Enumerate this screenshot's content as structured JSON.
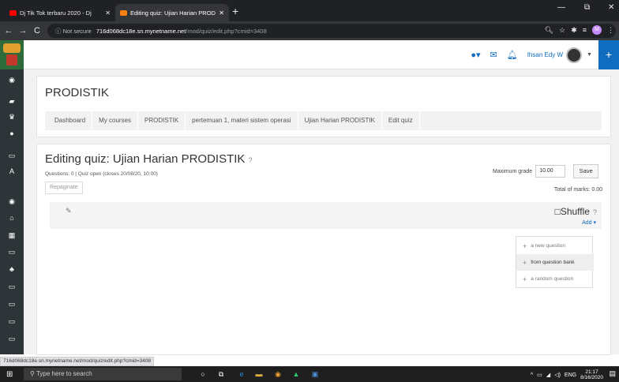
{
  "browser": {
    "tabs": [
      {
        "title": "Dj Tik Tok terbaru 2020 - Dj",
        "close": "✕",
        "favicon_color": "#ff0000"
      },
      {
        "title": "Editing quiz: Ujian Harian PRODI",
        "close": "✕",
        "favicon_color": "#f98012"
      }
    ],
    "new_tab": "+",
    "window_controls": {
      "minimize": "—",
      "maximize": "⧉",
      "close": "✕"
    },
    "back": "←",
    "forward": "→",
    "reload": "C",
    "security": "ⓘ Not secure",
    "url_domain": "716d068dc18e.sn.mynetname.net",
    "url_path": "/mod/quiz/edit.php?cmid=3408",
    "profile_initial": "M",
    "status_url": "716d068dc18e.sn.mynetname.net/mod/quiz/edit.php?cmid=3408"
  },
  "navbar": {
    "user_name": "Ihsan Edy W",
    "plus": "+"
  },
  "page": {
    "course_title": "PRODISTIK",
    "breadcrumbs": [
      "Dashboard",
      "My courses",
      "PRODISTIK",
      "pertemuan 1, materi sistem operasi",
      "Ujian Harian PRODISTIK",
      "Edit quiz"
    ],
    "quiz_title": "Editing quiz: Ujian Harian PRODISTIK",
    "help_icon": "?",
    "quiz_info": "Questions: 0 | Quiz open (closes 20/08/20, 10:00)",
    "repaginate": "Repaginate",
    "max_grade_label": "Maximum grade",
    "max_grade_value": "10.00",
    "save": "Save",
    "total_marks": "Total of marks: 0.00",
    "shuffle": "Shuffle",
    "add": "Add ▾",
    "add_menu": [
      "a new question",
      "from question bank",
      "a random question"
    ]
  },
  "taskbar": {
    "search_placeholder": "Type here to search",
    "language": "ENG",
    "time": "21:17",
    "date": "8/16/2020"
  }
}
